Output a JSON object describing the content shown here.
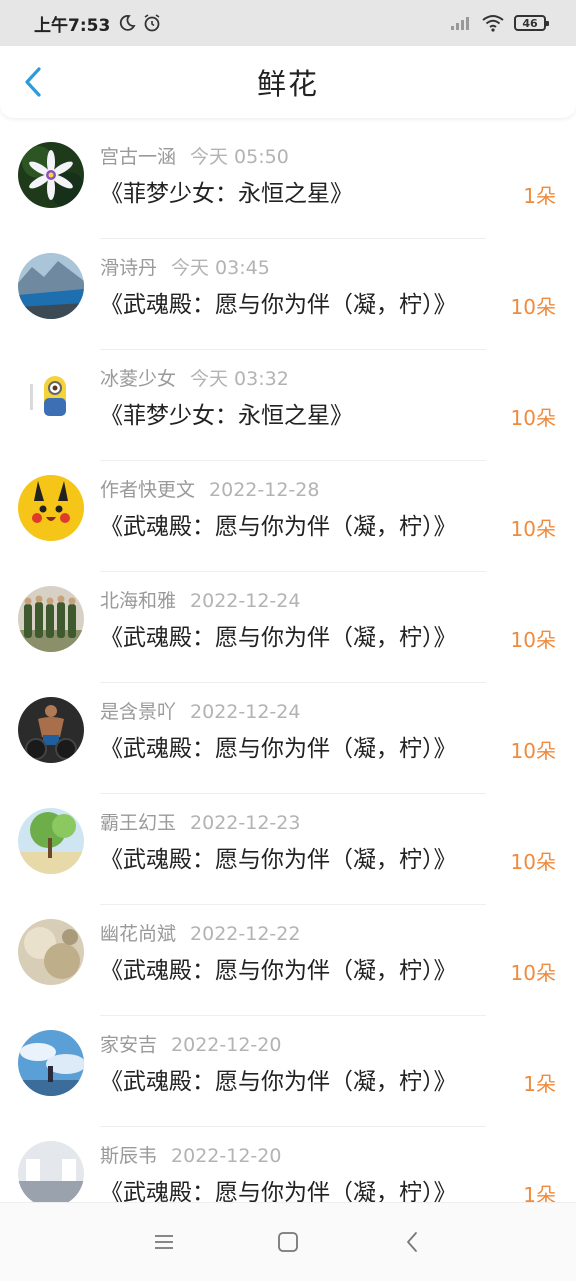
{
  "status": {
    "time": "上午7:53",
    "battery": "46"
  },
  "header": {
    "title": "鲜花"
  },
  "colors": {
    "accent_blue": "#2d9bd8",
    "count_orange": "#f08a3c"
  },
  "items": [
    {
      "name": "宫古一涵",
      "time": "今天 05:50",
      "book": "《菲梦少女：永恒之星》",
      "count": "1朵",
      "avatar": "flower"
    },
    {
      "name": "滑诗丹",
      "time": "今天 03:45",
      "book": "《武魂殿：愿与你为伴（凝，柠）》",
      "count": "10朵",
      "avatar": "mountain"
    },
    {
      "name": "冰菱少女",
      "time": "今天 03:32",
      "book": "《菲梦少女：永恒之星》",
      "count": "10朵",
      "avatar": "minion"
    },
    {
      "name": "作者快更文",
      "time": "2022-12-28",
      "book": "《武魂殿：愿与你为伴（凝，柠）》",
      "count": "10朵",
      "avatar": "pikachu"
    },
    {
      "name": "北海和雅",
      "time": "2022-12-24",
      "book": "《武魂殿：愿与你为伴（凝，柠）》",
      "count": "10朵",
      "avatar": "soldiers"
    },
    {
      "name": "是含景吖",
      "time": "2022-12-24",
      "book": "《武魂殿：愿与你为伴（凝，柠）》",
      "count": "10朵",
      "avatar": "man"
    },
    {
      "name": "霸王幻玉",
      "time": "2022-12-23",
      "book": "《武魂殿：愿与你为伴（凝，柠）》",
      "count": "10朵",
      "avatar": "tree"
    },
    {
      "name": "幽花尚斌",
      "time": "2022-12-22",
      "book": "《武魂殿：愿与你为伴（凝，柠）》",
      "count": "10朵",
      "avatar": "blur"
    },
    {
      "name": "家安吉",
      "time": "2022-12-20",
      "book": "《武魂殿：愿与你为伴（凝，柠）》",
      "count": "1朵",
      "avatar": "sky"
    },
    {
      "name": "斯辰韦",
      "time": "2022-12-20",
      "book": "《武魂殿：愿与你为伴（凝，柠）》",
      "count": "1朵",
      "avatar": "room"
    }
  ]
}
